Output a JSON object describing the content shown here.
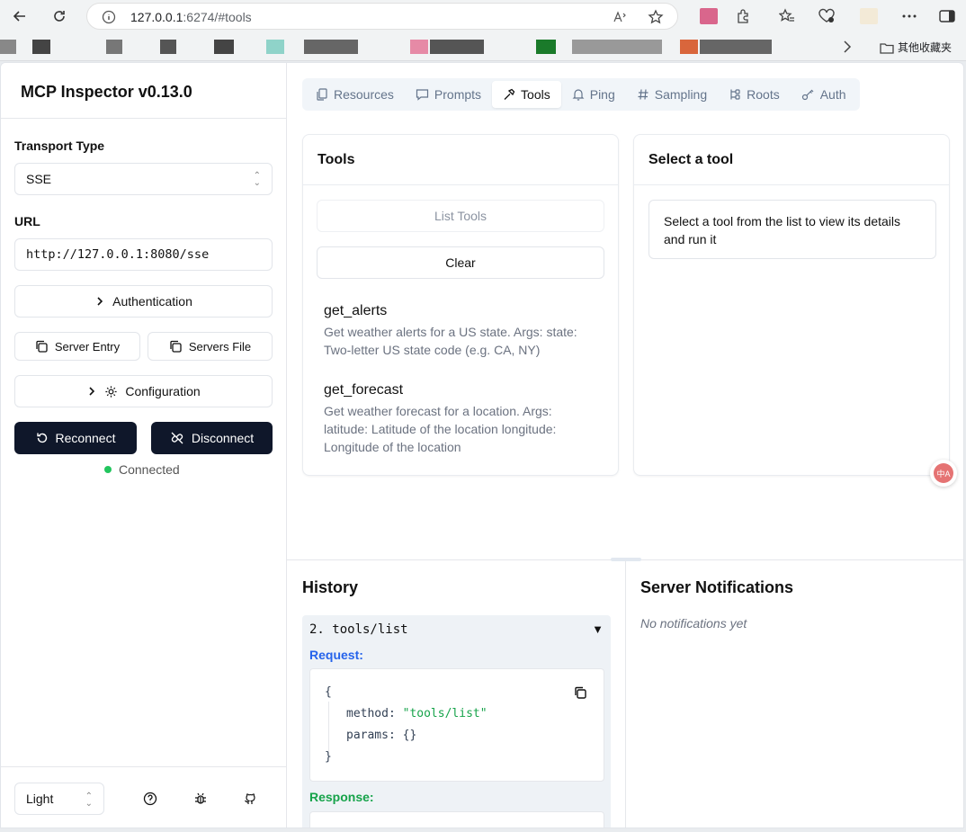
{
  "browser": {
    "url_host": "127.0.0.1",
    "url_rest": ":6274/#tools",
    "bookmark_folder": "其他收藏夹",
    "translate_icon_text": "中A"
  },
  "sidebar": {
    "title": "MCP Inspector v0.13.0",
    "transport_label": "Transport Type",
    "transport_value": "SSE",
    "url_label": "URL",
    "url_value": "http://127.0.0.1:8080/sse",
    "auth_button": "Authentication",
    "server_entry_button": "Server Entry",
    "servers_file_button": "Servers File",
    "config_button": "Configuration",
    "reconnect_button": "Reconnect",
    "disconnect_button": "Disconnect",
    "status": "Connected",
    "status_color": "#22c55e",
    "theme_value": "Light"
  },
  "tabs": [
    {
      "label": "Resources",
      "icon": "files-icon"
    },
    {
      "label": "Prompts",
      "icon": "message-icon"
    },
    {
      "label": "Tools",
      "icon": "hammer-icon",
      "active": true
    },
    {
      "label": "Ping",
      "icon": "bell-icon"
    },
    {
      "label": "Sampling",
      "icon": "hash-icon"
    },
    {
      "label": "Roots",
      "icon": "tree-icon"
    },
    {
      "label": "Auth",
      "icon": "key-icon"
    }
  ],
  "tools_panel": {
    "title": "Tools",
    "list_button": "List Tools",
    "clear_button": "Clear",
    "items": [
      {
        "name": "get_alerts",
        "desc": "Get weather alerts for a US state. Args: state: Two-letter US state code (e.g. CA, NY)"
      },
      {
        "name": "get_forecast",
        "desc": "Get weather forecast for a location. Args: latitude: Latitude of the location longitude: Longitude of the location"
      }
    ]
  },
  "detail_panel": {
    "title": "Select a tool",
    "hint": "Select a tool from the list to view its details and run it"
  },
  "history": {
    "title": "History",
    "entry_title": "2. tools/list",
    "toggle": "▼",
    "request_label": "Request:",
    "request_color": "#2563eb",
    "response_label": "Response:",
    "response_color": "#16a34a",
    "code": {
      "open": "{",
      "method_key": "method:",
      "method_val": "\"tools/list\"",
      "params_key": "params:",
      "params_val": "{}",
      "close": "}"
    }
  },
  "notifications": {
    "title": "Server Notifications",
    "empty": "No notifications yet"
  }
}
